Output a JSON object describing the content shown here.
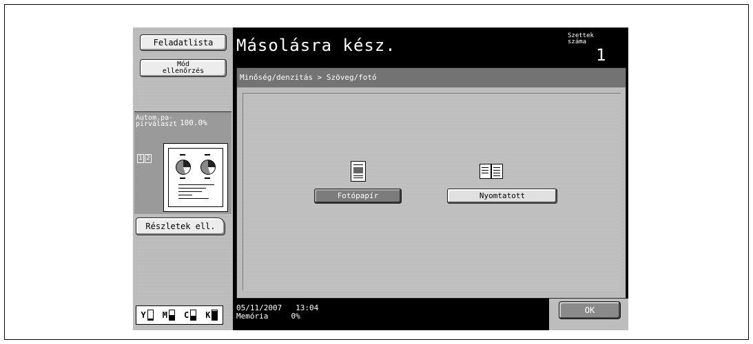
{
  "left_panel": {
    "job_list_label": "Feladatlista",
    "mode_check_label_line1": "Mód",
    "mode_check_label_line2": "ellenőrzés",
    "preview_label_line1": "Autom.pa-",
    "preview_label_line2": "pírválaszt",
    "zoom": "100.0%",
    "page_indicator": "1 2",
    "details_label": "Részletek ell."
  },
  "toner": {
    "items": [
      {
        "letter": "Y",
        "level": 0.15
      },
      {
        "letter": "M",
        "level": 0.5
      },
      {
        "letter": "C",
        "level": 0.4
      },
      {
        "letter": "K",
        "level": 0.95
      }
    ]
  },
  "header": {
    "title": "Másolásra kész.",
    "count_label_line1": "Szettek",
    "count_label_line2": "száma",
    "count_value": "1"
  },
  "main": {
    "breadcrumb": "Minőség/denzitás > Szöveg/fotó",
    "option_photo_paper": "Fotópapír",
    "option_printed": "Nyomtatott",
    "selected_option": "Fotópapír"
  },
  "footer": {
    "date": "05/11/2007",
    "time": "13:04",
    "memory_label": "Memória",
    "memory_value": "0%",
    "ok_label": "OK"
  }
}
